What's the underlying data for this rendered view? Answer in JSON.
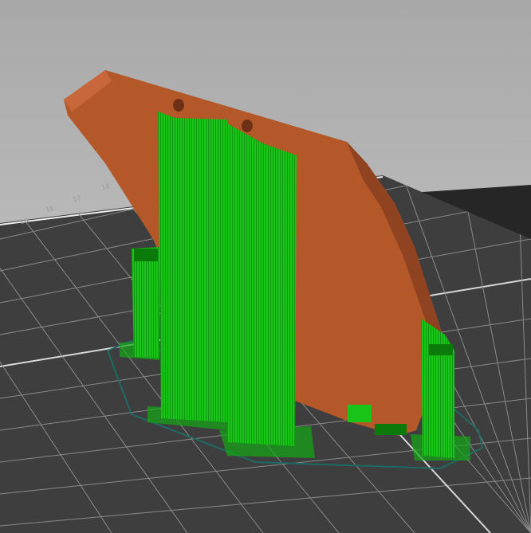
{
  "viewport": {
    "title": "3D preview",
    "bed_labels": [
      "15",
      "16",
      "17",
      "18"
    ],
    "colors": {
      "background_top": "#a9a9a9",
      "background_bottom": "#c9c9c9",
      "bed": "#3e3e3e",
      "bed_back": "#262626",
      "grid": "#8a8a8a",
      "part": "#b4582a",
      "part_shade": "#8f4320",
      "support": "#17c417",
      "support_dark": "#0b7a0b",
      "skirt": "#1d6b63"
    }
  }
}
